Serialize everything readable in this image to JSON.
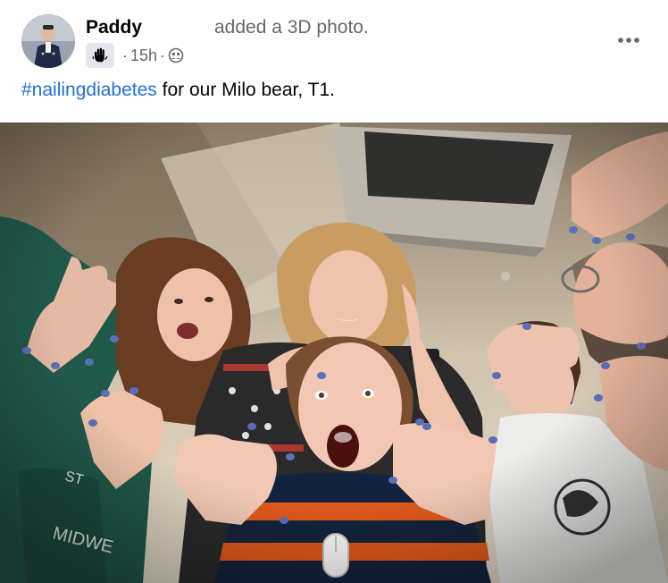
{
  "post": {
    "author": "Paddy",
    "action": "added a 3D photo.",
    "time": "15h",
    "separator": "·",
    "text_hashtag": "#nailingdiabetes",
    "text_rest": " for our Milo bear, T1."
  },
  "icons": {
    "badge": "hand-wave-icon",
    "audience": "friends-audience-icon",
    "more": "more-options-icon"
  },
  "colors": {
    "hashtag": "#216fdb",
    "meta": "#65676b",
    "text": "#050505",
    "nail_polish": "#5b6fb8"
  }
}
